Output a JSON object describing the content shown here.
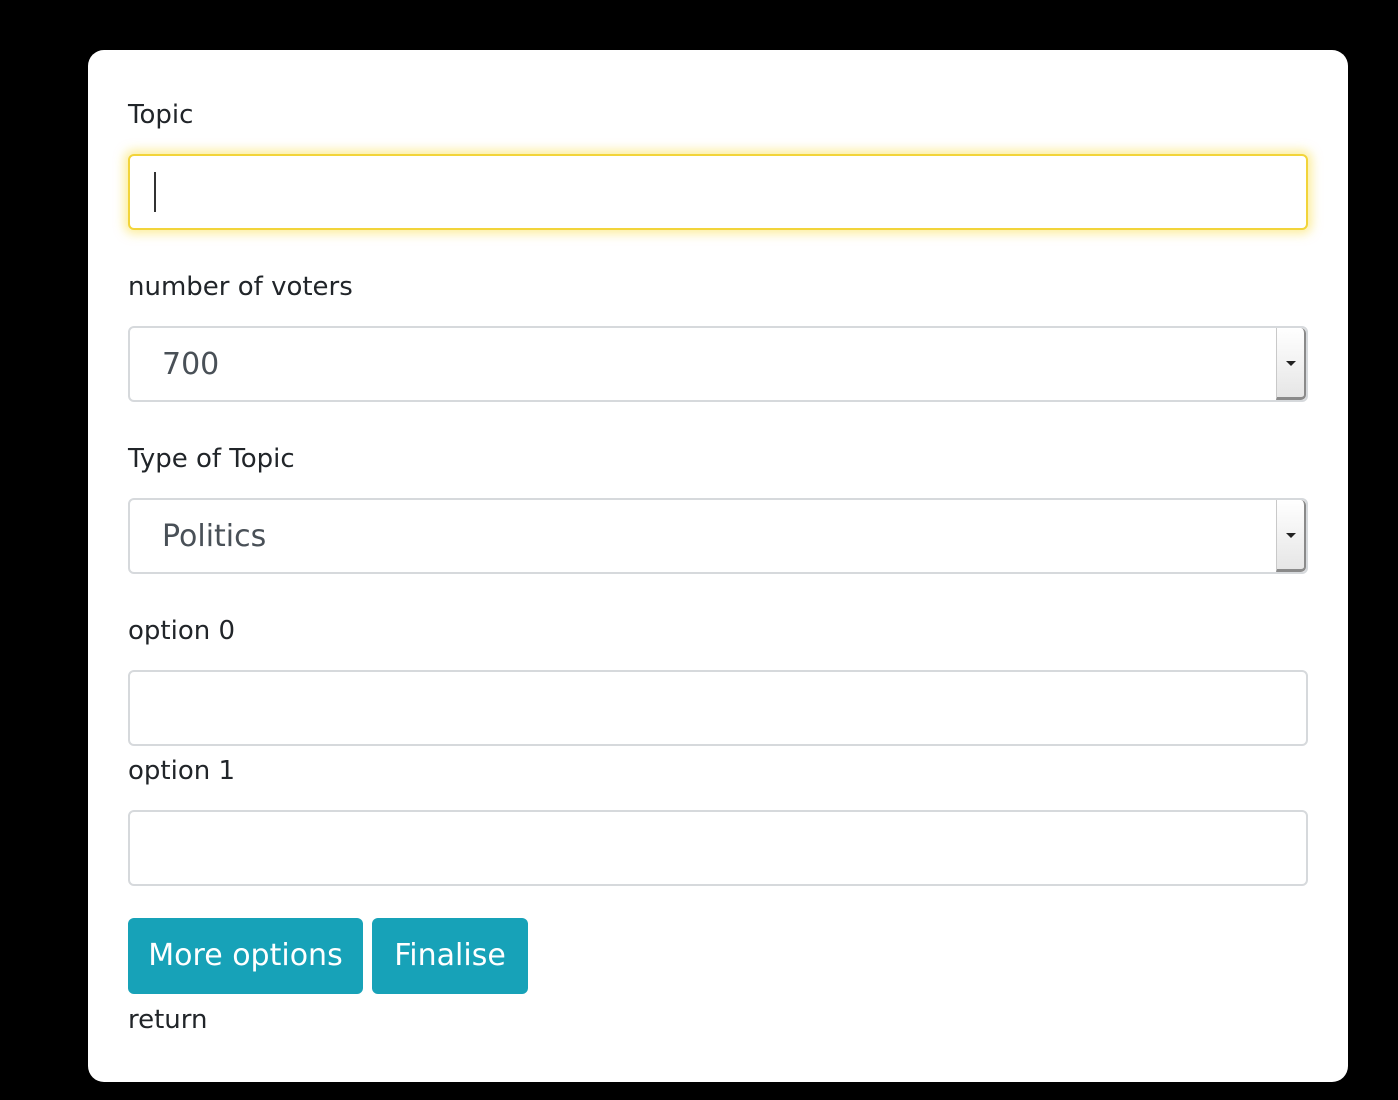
{
  "form": {
    "topic": {
      "label": "Topic",
      "value": ""
    },
    "voters": {
      "label": "number of voters",
      "selected": "700"
    },
    "topic_type": {
      "label": "Type of Topic",
      "selected": "Politics"
    },
    "options": [
      {
        "label": "option 0",
        "value": ""
      },
      {
        "label": "option 1",
        "value": ""
      }
    ],
    "buttons": {
      "more_options": "More options",
      "finalise": "Finalise"
    },
    "return_link": "return"
  }
}
